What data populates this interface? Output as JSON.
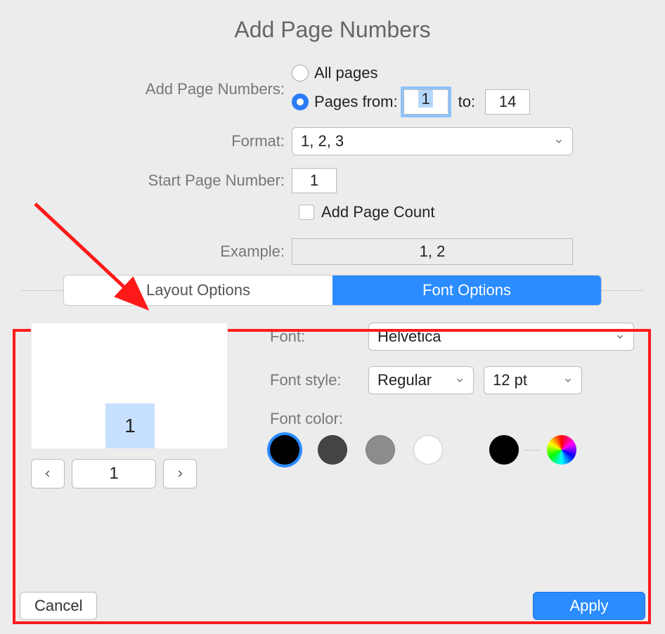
{
  "title": "Add Page Numbers",
  "form": {
    "add_page_numbers_label": "Add Page Numbers:",
    "all_pages_label": "All pages",
    "pages_from_label": "Pages from:",
    "pages_to_label": "to:",
    "from_value": "1",
    "to_value": "14",
    "selected_option": "range",
    "format_label": "Format:",
    "format_value": "1, 2, 3",
    "start_label": "Start Page Number:",
    "start_value": "1",
    "add_page_count_label": "Add Page Count",
    "example_label": "Example:",
    "example_value": "1, 2"
  },
  "tabs": {
    "layout": "Layout Options",
    "font": "Font Options",
    "active": "font"
  },
  "preview": {
    "number": "1",
    "page_input": "1"
  },
  "font": {
    "font_label": "Font:",
    "font_value": "Helvetica",
    "style_label": "Font style:",
    "style_value": "Regular",
    "size_value": "12 pt",
    "color_label": "Font color:"
  },
  "buttons": {
    "cancel": "Cancel",
    "apply": "Apply"
  }
}
